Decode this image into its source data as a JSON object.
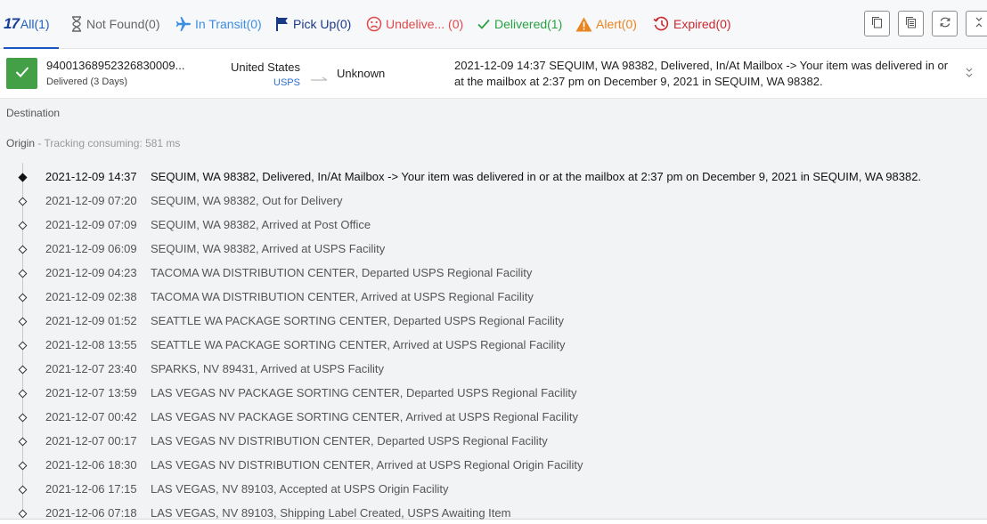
{
  "filters": {
    "all": "All(1)",
    "not_found": "Not Found(0)",
    "in_transit": "In Transit(0)",
    "pick_up": "Pick Up(0)",
    "undelivered": "Undelive... (0)",
    "delivered": "Delivered(1)",
    "alert": "Alert(0)",
    "expired": "Expired(0)",
    "logo": "17"
  },
  "summary": {
    "tracking_number": "94001368952326830009...",
    "status": "Delivered (3 Days)",
    "origin_country": "United States",
    "carrier": "USPS",
    "destination_country": "Unknown",
    "latest_event": "2021-12-09 14:37  SEQUIM, WA 98382, Delivered, In/At Mailbox -> Your item was delivered in or at the mailbox at 2:37 pm on December 9, 2021 in SEQUIM, WA 98382."
  },
  "detail": {
    "destination_label": "Destination",
    "origin_label": "Origin",
    "consume_text": " - Tracking consuming: 581 ms"
  },
  "events": [
    {
      "time": "2021-12-09 14:37",
      "desc": "SEQUIM, WA 98382, Delivered, In/At Mailbox -> Your item was delivered in or at the mailbox at 2:37 pm on December 9, 2021 in SEQUIM, WA 98382."
    },
    {
      "time": "2021-12-09 07:20",
      "desc": "SEQUIM, WA 98382, Out for Delivery"
    },
    {
      "time": "2021-12-09 07:09",
      "desc": "SEQUIM, WA 98382, Arrived at Post Office"
    },
    {
      "time": "2021-12-09 06:09",
      "desc": "SEQUIM, WA 98382, Arrived at USPS Facility"
    },
    {
      "time": "2021-12-09 04:23",
      "desc": "TACOMA WA DISTRIBUTION CENTER, Departed USPS Regional Facility"
    },
    {
      "time": "2021-12-09 02:38",
      "desc": "TACOMA WA DISTRIBUTION CENTER, Arrived at USPS Regional Facility"
    },
    {
      "time": "2021-12-09 01:52",
      "desc": "SEATTLE WA PACKAGE SORTING CENTER, Departed USPS Regional Facility"
    },
    {
      "time": "2021-12-08 13:55",
      "desc": "SEATTLE WA PACKAGE SORTING CENTER, Arrived at USPS Regional Facility"
    },
    {
      "time": "2021-12-07 23:40",
      "desc": "SPARKS, NV 89431, Arrived at USPS Facility"
    },
    {
      "time": "2021-12-07 13:59",
      "desc": "LAS VEGAS NV PACKAGE SORTING CENTER, Departed USPS Regional Facility"
    },
    {
      "time": "2021-12-07 00:42",
      "desc": "LAS VEGAS NV PACKAGE SORTING CENTER, Arrived at USPS Regional Facility"
    },
    {
      "time": "2021-12-07 00:17",
      "desc": "LAS VEGAS NV DISTRIBUTION CENTER, Departed USPS Regional Facility"
    },
    {
      "time": "2021-12-06 18:30",
      "desc": "LAS VEGAS NV DISTRIBUTION CENTER, Arrived at USPS Regional Origin Facility"
    },
    {
      "time": "2021-12-06 17:15",
      "desc": "LAS VEGAS, NV 89103, Accepted at USPS Origin Facility"
    },
    {
      "time": "2021-12-06 07:18",
      "desc": "LAS VEGAS, NV 89103, Shipping Label Created, USPS Awaiting Item"
    }
  ],
  "colors": {
    "accent": "#1a57c2",
    "delivered_green": "#43a047",
    "alert_orange": "#e8851f",
    "expired_red": "#c9282e",
    "undelivered_red": "#e0484a",
    "transit_blue": "#3c8ee0"
  },
  "icons": {
    "not_found": "hourglass-icon",
    "in_transit": "airplane-icon",
    "pick_up": "flag-icon",
    "undelivered": "sad-face-icon",
    "delivered": "checkmark-icon",
    "alert": "warning-triangle-icon",
    "expired": "clock-history-icon",
    "tools": [
      "copy-icon",
      "copy-all-icon",
      "refresh-icon",
      "expand-collapse-icon"
    ]
  }
}
